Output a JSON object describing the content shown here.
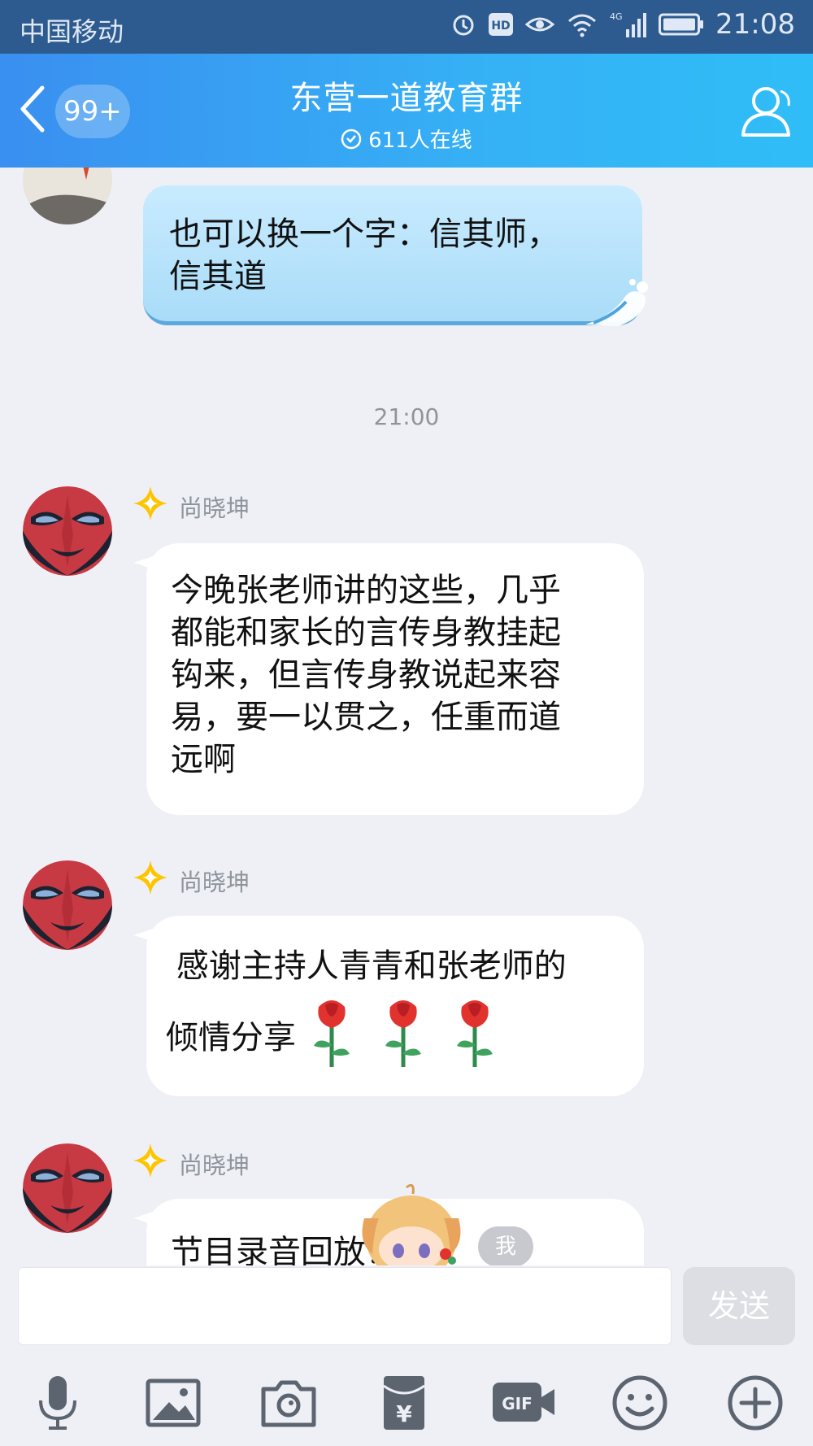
{
  "status_bar": {
    "carrier": "中国移动",
    "network": "4G",
    "time": "21:08"
  },
  "header": {
    "unread_badge": "99+",
    "title": "东营一道教育群",
    "online_text": "611人在线"
  },
  "messages": [
    {
      "type": "self",
      "text": "也可以换一个字：信其师，\n信其道"
    },
    {
      "type": "timestamp",
      "text": "21:00"
    },
    {
      "type": "other",
      "sender": "尚晓坤",
      "text": "今晚张老师讲的这些，几乎\n都能和家长的言传身教挂起\n钩来，但言传身教说起来容\n易，要一以贯之，任重而道\n远啊"
    },
    {
      "type": "other",
      "sender": "尚晓坤",
      "text": " 感谢主持人青青和张老师的",
      "text2": "倾情分享",
      "emoji": [
        "rose",
        "rose",
        "rose"
      ]
    },
    {
      "type": "other",
      "sender": "尚晓坤",
      "text": "节目录音回放："
    }
  ],
  "floating": {
    "me_label": "我"
  },
  "input": {
    "value": "",
    "send_label": "发送"
  },
  "toolbar": [
    "microphone-icon",
    "image-icon",
    "camera-icon",
    "red-packet-icon",
    "gif-icon",
    "emoji-icon",
    "plus-icon"
  ],
  "colors": {
    "header_start": "#3a8ff0",
    "header_end": "#2fbdf7",
    "background": "#eef0f6"
  }
}
